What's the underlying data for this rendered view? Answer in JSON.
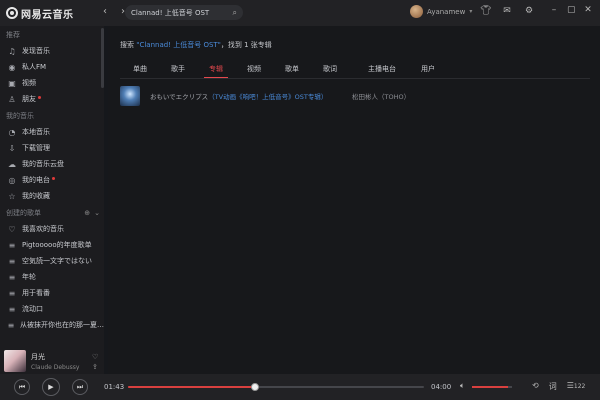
{
  "app": {
    "logo_text": "网易云音乐"
  },
  "titlebar": {
    "back": "‹",
    "forward": "›",
    "search_value": "Clannad! 上低音号 OST",
    "user_name": "Ayanamew",
    "icons": [
      "shirt-icon",
      "mail-icon",
      "gear-icon"
    ],
    "window": [
      "min",
      "max",
      "close"
    ]
  },
  "sidebar": {
    "groups": [
      {
        "title": "推荐",
        "items": [
          {
            "icon": "♫",
            "label": "发现音乐",
            "dot": false
          },
          {
            "icon": "◉",
            "label": "私人FM",
            "dot": false
          },
          {
            "icon": "▣",
            "label": "视频",
            "dot": false
          },
          {
            "icon": "♙",
            "label": "朋友",
            "dot": true
          }
        ]
      },
      {
        "title": "我的音乐",
        "items": [
          {
            "icon": "◔",
            "label": "本地音乐",
            "dot": false
          },
          {
            "icon": "⇩",
            "label": "下载管理",
            "dot": false
          },
          {
            "icon": "☁",
            "label": "我的音乐云盘",
            "dot": false
          },
          {
            "icon": "◎",
            "label": "我的电台",
            "dot": true
          },
          {
            "icon": "☆",
            "label": "我的收藏",
            "dot": false
          }
        ]
      },
      {
        "title": "创建的歌单",
        "items": [
          {
            "icon": "♡",
            "label": "我喜欢的音乐",
            "dot": false
          },
          {
            "icon": "≡",
            "label": "Pigtooooo的年度歌单",
            "dot": false
          },
          {
            "icon": "≡",
            "label": "空気読一文字ではない",
            "dot": false
          },
          {
            "icon": "≡",
            "label": "年轮",
            "dot": false
          },
          {
            "icon": "≡",
            "label": "用于看番",
            "dot": false
          },
          {
            "icon": "≡",
            "label": "流动口",
            "dot": false
          },
          {
            "icon": "≡",
            "label": "从被抹开你也在的那一夏…",
            "dot": false
          }
        ]
      }
    ]
  },
  "mini_player": {
    "title": "月光",
    "artist": "Claude Debussy"
  },
  "main": {
    "result_prefix": "搜索",
    "result_keyword": "\"Clannad! 上低音号 OST\"",
    "result_suffix": "，找到 1 张专辑",
    "tabs": [
      {
        "label": "单曲",
        "active": false
      },
      {
        "label": "歌手",
        "active": false
      },
      {
        "label": "专辑",
        "active": true
      },
      {
        "label": "视频",
        "active": false
      },
      {
        "label": "歌单",
        "active": false
      },
      {
        "label": "歌词",
        "active": false
      },
      {
        "label": "主播电台",
        "active": false
      },
      {
        "label": "用户",
        "active": false
      }
    ],
    "albums": [
      {
        "title_main": "おもいでエクリプス",
        "title_paren": "（TV动画《响吧！上低音号》OST专辑）",
        "artist": "松田彬人（TOHO）"
      }
    ]
  },
  "player": {
    "current_time": "01:43",
    "total_time": "04:00",
    "progress": 0.43,
    "volume": 0.9,
    "playlist_count": "122",
    "prev_label": "⏮",
    "play_label": "▶",
    "next_label": "⏭",
    "colors": {
      "accent": "#d8403f",
      "active_tab": "#e5484d",
      "link": "#4a8ad8"
    }
  }
}
